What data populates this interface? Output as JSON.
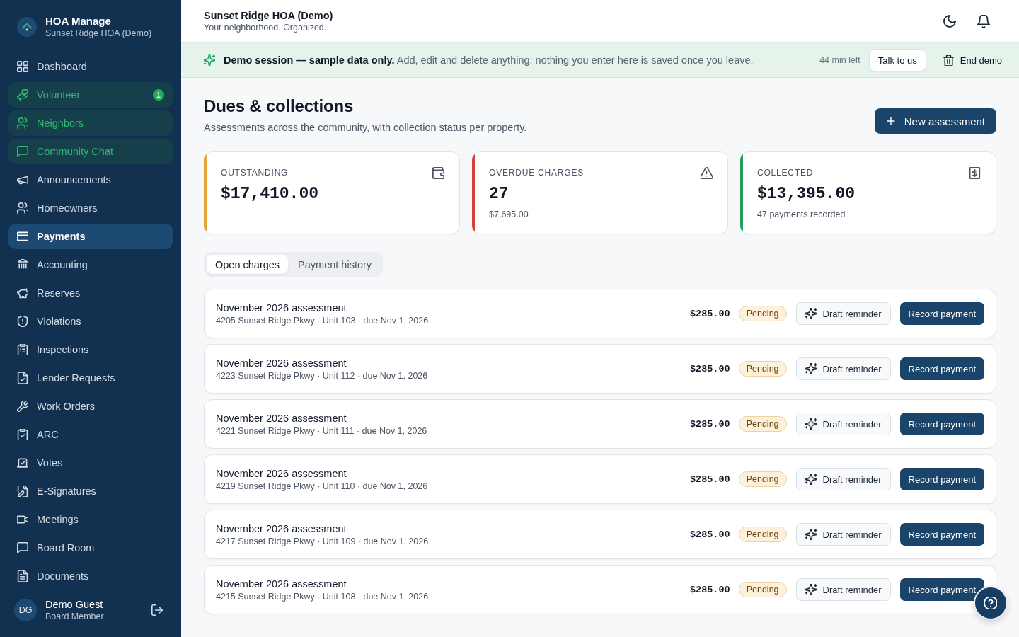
{
  "sidebar": {
    "brand": {
      "name": "HOA Manage",
      "subtitle": "Sunset Ridge HOA (Demo)"
    },
    "nav_items": [
      {
        "label": "Dashboard",
        "selected": false,
        "highlighted": false
      },
      {
        "label": "Volunteer",
        "selected": false,
        "highlighted": true,
        "badge": "1"
      },
      {
        "label": "Neighbors",
        "selected": false,
        "highlighted": true
      },
      {
        "label": "Community Chat",
        "selected": false,
        "highlighted": true
      },
      {
        "label": "Announcements",
        "selected": false,
        "highlighted": false
      },
      {
        "label": "Homeowners",
        "selected": false,
        "highlighted": false
      },
      {
        "label": "Payments",
        "selected": true,
        "highlighted": false
      },
      {
        "label": "Accounting",
        "selected": false,
        "highlighted": false
      },
      {
        "label": "Reserves",
        "selected": false,
        "highlighted": false
      },
      {
        "label": "Violations",
        "selected": false,
        "highlighted": false
      },
      {
        "label": "Inspections",
        "selected": false,
        "highlighted": false
      },
      {
        "label": "Lender Requests",
        "selected": false,
        "highlighted": false
      },
      {
        "label": "Work Orders",
        "selected": false,
        "highlighted": false
      },
      {
        "label": "ARC",
        "selected": false,
        "highlighted": false
      },
      {
        "label": "Votes",
        "selected": false,
        "highlighted": false
      },
      {
        "label": "E-Signatures",
        "selected": false,
        "highlighted": false
      },
      {
        "label": "Meetings",
        "selected": false,
        "highlighted": false
      },
      {
        "label": "Board Room",
        "selected": false,
        "highlighted": false
      },
      {
        "label": "Documents",
        "selected": false,
        "highlighted": false
      }
    ],
    "user": {
      "initials": "DG",
      "name": "Demo Guest",
      "role": "Board Member"
    }
  },
  "header": {
    "title": "Sunset Ridge HOA (Demo)",
    "subtitle": "Your neighborhood. Organized."
  },
  "demo_banner": {
    "message": "**Demo session — sample data only.** Add, edit and delete anything: nothing you enter here is saved once you leave.",
    "time_left": "44 min left",
    "contact_button": "Talk to us",
    "end_button": "End demo"
  },
  "page": {
    "title": "Dues & collections",
    "subtitle": "Assessments across the community, with collection status per property.",
    "primary_action": "New assessment"
  },
  "stats": [
    {
      "label": "OUTSTANDING",
      "value": "$17,410.00",
      "color": "#e8a23a"
    },
    {
      "label": "OVERDUE CHARGES",
      "value": "27",
      "detail": "$7,695.00",
      "color": "#d6403a"
    },
    {
      "label": "COLLECTED",
      "value": "$13,395.00",
      "detail": "47 payments recorded",
      "color": "#22a05a"
    }
  ],
  "tabs": [
    {
      "label": "Open charges",
      "selected": true
    },
    {
      "label": "Payment history",
      "selected": false
    }
  ],
  "charges": [
    {
      "title": "November 2026 assessment",
      "detail": "4205 Sunset Ridge Pkwy · Unit 103 · due Nov 1, 2026",
      "amount": "$285.00",
      "status": "Pending",
      "reminder_action": "Draft reminder",
      "payment_action": "Record payment"
    },
    {
      "title": "November 2026 assessment",
      "detail": "4223 Sunset Ridge Pkwy · Unit 112 · due Nov 1, 2026",
      "amount": "$285.00",
      "status": "Pending",
      "reminder_action": "Draft reminder",
      "payment_action": "Record payment"
    },
    {
      "title": "November 2026 assessment",
      "detail": "4221 Sunset Ridge Pkwy · Unit 111 · due Nov 1, 2026",
      "amount": "$285.00",
      "status": "Pending",
      "reminder_action": "Draft reminder",
      "payment_action": "Record payment"
    },
    {
      "title": "November 2026 assessment",
      "detail": "4219 Sunset Ridge Pkwy · Unit 110 · due Nov 1, 2026",
      "amount": "$285.00",
      "status": "Pending",
      "reminder_action": "Draft reminder",
      "payment_action": "Record payment"
    },
    {
      "title": "November 2026 assessment",
      "detail": "4217 Sunset Ridge Pkwy · Unit 109 · due Nov 1, 2026",
      "amount": "$285.00",
      "status": "Pending",
      "reminder_action": "Draft reminder",
      "payment_action": "Record payment"
    },
    {
      "title": "November 2026 assessment",
      "detail": "4215 Sunset Ridge Pkwy · Unit 108 · due Nov 1, 2026",
      "amount": "$285.00",
      "status": "Pending",
      "reminder_action": "Draft reminder",
      "payment_action": "Record payment"
    }
  ]
}
